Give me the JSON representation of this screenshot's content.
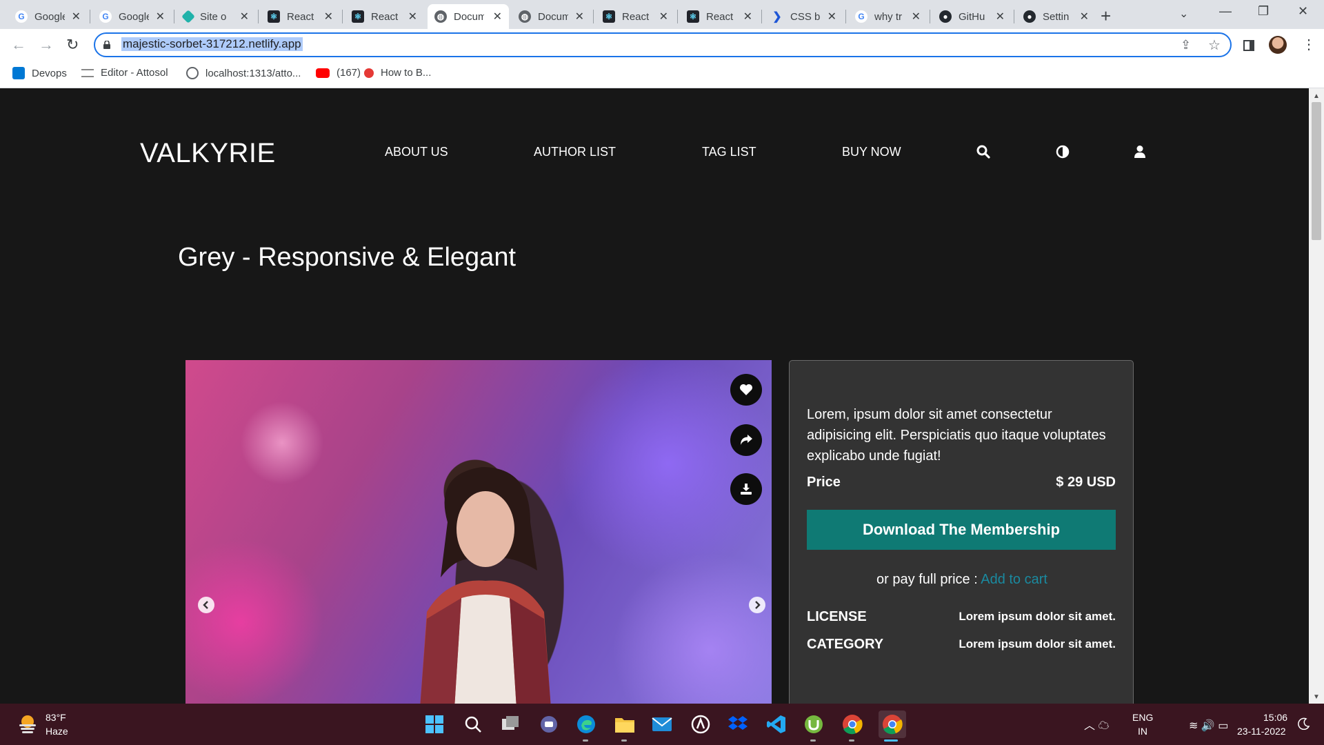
{
  "browser": {
    "tabs": [
      {
        "label": "Google",
        "favicon": "google-icon",
        "active": false
      },
      {
        "label": "Google",
        "favicon": "google-icon",
        "active": false
      },
      {
        "label": "Site o",
        "favicon": "netlify-icon",
        "active": false
      },
      {
        "label": "React",
        "favicon": "react-icon",
        "active": false
      },
      {
        "label": "React",
        "favicon": "react-icon",
        "active": false
      },
      {
        "label": "Docum",
        "favicon": "globe-icon",
        "active": true
      },
      {
        "label": "Docum",
        "favicon": "globe-icon",
        "active": false
      },
      {
        "label": "React",
        "favicon": "react-icon",
        "active": false
      },
      {
        "label": "React",
        "favicon": "react-icon",
        "active": false
      },
      {
        "label": "CSS b",
        "favicon": "codepen-icon",
        "active": false
      },
      {
        "label": "why tr",
        "favicon": "google-icon",
        "active": false
      },
      {
        "label": "GitHu",
        "favicon": "github-icon",
        "active": false
      },
      {
        "label": "Settin",
        "favicon": "github-icon",
        "active": false
      }
    ],
    "url": "majestic-sorbet-317212.netlify.app",
    "bookmarks": [
      {
        "label": "Devops",
        "icon": "azure-devops-icon"
      },
      {
        "label": "Editor - Attosol",
        "icon": "doc-lines-icon"
      },
      {
        "label": "localhost:1313/atto...",
        "icon": "globe-icon"
      },
      {
        "label": "(167)",
        "icon": "youtube-icon"
      },
      {
        "label": "How to B...",
        "icon": "red-dot-icon"
      }
    ]
  },
  "site": {
    "logo": "VALKYRIE",
    "nav": [
      "ABOUT US",
      "AUTHOR LIST",
      "TAG LIST",
      "BUY NOW"
    ],
    "nav_icons": [
      "search-icon",
      "contrast-icon",
      "user-icon"
    ],
    "title": "Grey - Responsive & Elegant",
    "hero_actions": [
      "heart-icon",
      "share-icon",
      "download-icon"
    ],
    "card": {
      "description": "Lorem, ipsum dolor sit amet consectetur adipisicing elit. Perspiciatis quo itaque voluptates explicabo unde fugiat!",
      "price_label": "Price",
      "price_value": "$ 29 USD",
      "download_label": "Download The Membership",
      "pay_text": "or pay full price :",
      "add_to_cart": "Add to cart",
      "license_label": "LICENSE",
      "license_value": "Lorem ipsum dolor sit amet.",
      "category_label": "CATEGORY",
      "category_value": "Lorem ipsum dolor sit amet."
    },
    "colors": {
      "background": "#171717",
      "card": "#333333",
      "accent": "#0f7a74",
      "link": "#1a8aa0"
    }
  },
  "taskbar": {
    "weather_temp": "83°F",
    "weather_condition": "Haze",
    "apps": [
      "windows-start-icon",
      "search-icon",
      "task-view-icon",
      "chat-icon",
      "edge-icon",
      "file-explorer-icon",
      "mail-icon",
      "app-icon",
      "dropbox-icon",
      "vscode-icon",
      "utorrent-icon",
      "chrome-icon",
      "chrome-icon"
    ],
    "lang_1": "ENG",
    "lang_2": "IN",
    "time": "15:06",
    "date": "23-11-2022"
  }
}
